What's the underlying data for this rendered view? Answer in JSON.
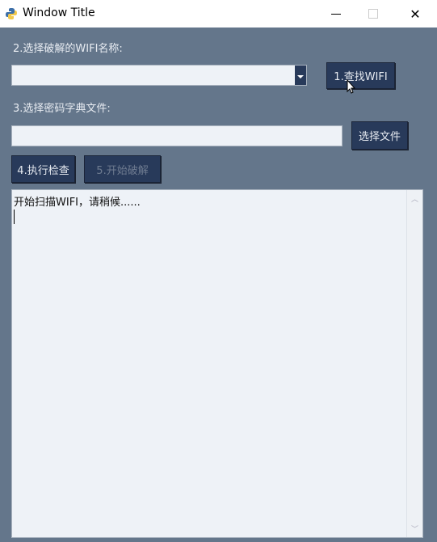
{
  "window": {
    "title": "Window Title",
    "minimize_icon": "minimize-icon",
    "maximize_icon": "maximize-icon",
    "close_icon": "close-icon"
  },
  "wifi": {
    "label": "2.选择破解的WIFI名称:",
    "selected": "",
    "find_button": "1.查找WIFI"
  },
  "dict": {
    "label": "3.选择密码字典文件:",
    "value": "",
    "choose_button": "选择文件"
  },
  "actions": {
    "check_button": "4.执行检查",
    "crack_button": "5.开始破解"
  },
  "log": {
    "text": "开始扫描WIFI，请稍候......"
  },
  "colors": {
    "background": "#64768b",
    "button": "#283a5a",
    "field": "#eef2f7"
  }
}
